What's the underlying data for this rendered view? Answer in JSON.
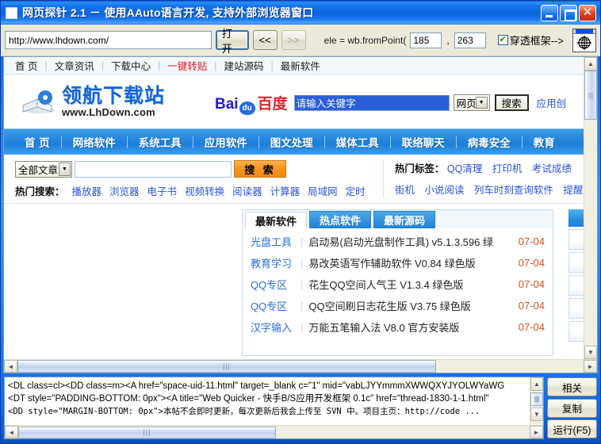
{
  "window": {
    "title": "网页探针 2.1  －   使用AAuto语言开发, 支持外部浏览器窗口",
    "icon": "app-icon",
    "minimize_label": "_",
    "maximize_label": "□",
    "close_label": "✕"
  },
  "toolbar": {
    "url_value": "http://www.lhdown.com/",
    "url_placeholder": "",
    "open_label": "打开",
    "back_label": "<<",
    "forward_label": ">>",
    "formula_label": "ele = wb.fromPoint(",
    "coord_x": "185",
    "coord_y": "263",
    "comma": ",",
    "frame_checkbox_checked": true,
    "frame_label": "穿透框架-->",
    "target_icon_name": "crosshair-target-icon"
  },
  "site": {
    "topnav": [
      {
        "label": "首 页",
        "hot": false
      },
      {
        "label": "文章资讯",
        "hot": false
      },
      {
        "label": "下载中心",
        "hot": false
      },
      {
        "label": "一键转贴",
        "hot": true
      },
      {
        "label": "建站源码",
        "hot": false
      },
      {
        "label": "最新软件",
        "hot": false
      }
    ],
    "logo": {
      "cn": "领航下载站",
      "en": "www.LhDown.com",
      "mark_icon": "book-disc-logo-icon"
    },
    "baidu": {
      "brand_bai": "Bai",
      "brand_du": "du",
      "brand_cn": "百度",
      "input_value": "请输入关键字",
      "select_value": "网页",
      "search_label": "搜索",
      "extra_link": "应用创"
    },
    "categories": [
      "首 页",
      "网络软件",
      "系统工具",
      "应用软件",
      "图文处理",
      "媒体工具",
      "联络聊天",
      "病毒安全",
      "教育"
    ],
    "search": {
      "category_value": "全部文章",
      "keyword_value": "",
      "keyword_placeholder": "",
      "button_label": "搜 索",
      "hot_search_label": "热门搜索：",
      "hot_search_items": [
        "播放器",
        "浏览器",
        "电子书",
        "视频转换",
        "阅读器",
        "计算器",
        "局域网",
        "定时"
      ],
      "tags_label": "热门标签：",
      "tags_row1": [
        "QQ清理",
        "打印机",
        "考试成绩"
      ],
      "tags_row2": [
        "街机",
        "小说阅读",
        "列车时刻查询软件",
        "提醒"
      ]
    },
    "software_panel": {
      "tabs": [
        {
          "label": "最新软件",
          "active": true
        },
        {
          "label": "热点软件",
          "active": false
        },
        {
          "label": "最新源码",
          "active": false
        }
      ],
      "rows": [
        {
          "category": "光盘工具",
          "title": "启动易(启动光盘制作工具) v5.1.3.596 绿",
          "date": "07-04"
        },
        {
          "category": "教育学习",
          "title": "易改英语写作辅助软件 V0.84 绿色版",
          "date": "07-04"
        },
        {
          "category": "QQ专区",
          "title": "花生QQ空间人气王 V1.3.4 绿色版",
          "date": "07-04"
        },
        {
          "category": "QQ专区",
          "title": "QQ空间刷日志花生版 V3.75 绿色版",
          "date": "07-04"
        },
        {
          "category": "汉字输入",
          "title": "万能五笔输入法 V8.0 官方安装版",
          "date": "07-04"
        }
      ]
    }
  },
  "code_pane": {
    "lines": [
      "<DL class=cl><DD class=m><A href=\"space-uid-11.html\" target=_blank c=\"1\" mid=\"vabLJYYmmmXWWQXYJYOLWYaWG",
      "<DT style=\"PADDING-BOTTOM: 0px\"><A title=\"Web Quicker - 快手B/S应用开发框架 0.1c\" href=\"thread-1830-1-1.html\"",
      "<DD style=\"MARGIN-BOTTOM: 0px\">本帖不会即时更新，每次更新后我会上传至 SVN 中。项目主页：http://code ..."
    ],
    "buttons": [
      {
        "label": "相关",
        "name": "related-button"
      },
      {
        "label": "复制",
        "name": "copy-button"
      },
      {
        "label": "运行(F5)",
        "name": "run-button"
      }
    ]
  },
  "icons": {
    "scroll_up": "▲",
    "scroll_down": "▼",
    "scroll_left": "◄",
    "scroll_right": "►",
    "grip": "|||",
    "select_arrow": "▼"
  },
  "colors": {
    "title_blue": "#1476ee",
    "nav_blue": "#2486dd",
    "accent_orange": "#f79320",
    "hot_red": "#e01b1b",
    "date_orange": "#d8541b",
    "link_blue": "#2b53d8",
    "toolbar_bg": "#ece9d8"
  }
}
